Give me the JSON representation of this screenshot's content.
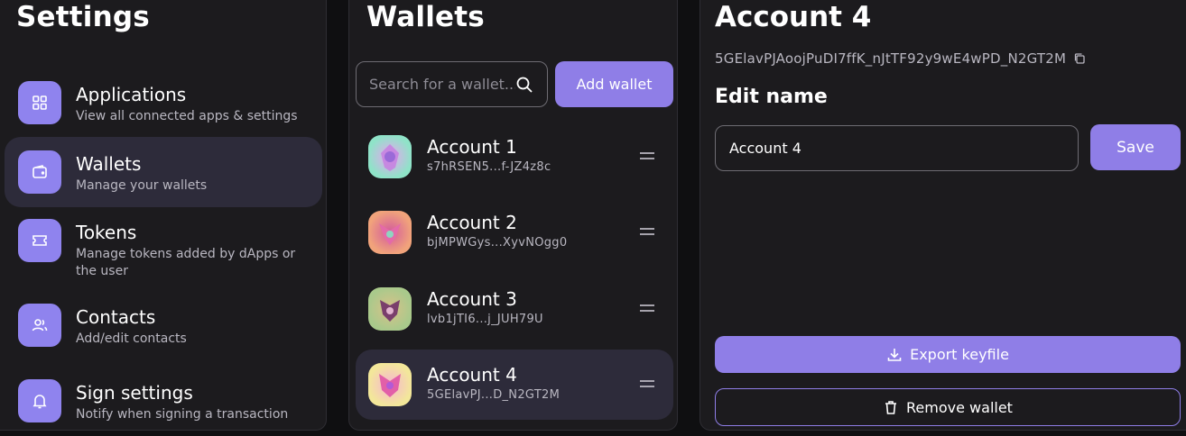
{
  "settings": {
    "title": "Settings",
    "items": [
      {
        "icon": "grid-icon",
        "label": "Applications",
        "description": "View all connected apps & settings"
      },
      {
        "icon": "wallet-icon",
        "label": "Wallets",
        "description": "Manage your wallets"
      },
      {
        "icon": "ticket-icon",
        "label": "Tokens",
        "description": "Manage tokens added by dApps or the user"
      },
      {
        "icon": "users-icon",
        "label": "Contacts",
        "description": "Add/edit contacts"
      },
      {
        "icon": "bell-icon",
        "label": "Sign settings",
        "description": "Notify when signing a transaction"
      }
    ],
    "active_index": 1
  },
  "wallets": {
    "title": "Wallets",
    "search_placeholder": "Search for a wallet...",
    "add_label": "Add wallet",
    "items": [
      {
        "name": "Account 1",
        "address": "s7hRSEN5...f-JZ4z8c",
        "avatar_colors": [
          "#8fe3c8",
          "#c77fe0"
        ]
      },
      {
        "name": "Account 2",
        "address": "bjMPWGys...XyvNOgg0",
        "avatar_colors": [
          "#f1a37b",
          "#d35a9c"
        ]
      },
      {
        "name": "Account 3",
        "address": "lvb1jTI6...j_JUH79U",
        "avatar_colors": [
          "#a9c98b",
          "#9a5a8c"
        ]
      },
      {
        "name": "Account 4",
        "address": "5GElavPJ...D_N2GT2M",
        "avatar_colors": [
          "#f3e79a",
          "#e25fa8"
        ]
      }
    ],
    "active_index": 3
  },
  "detail": {
    "title": "Account 4",
    "address": "5GElavPJAoojPuDI7ffK_nJtTF92y9wE4wPD_N2GT2M",
    "edit_name_title": "Edit name",
    "name_value": "Account 4",
    "save_label": "Save",
    "export_label": "Export keyfile",
    "remove_label": "Remove wallet"
  },
  "colors": {
    "accent": "#8f7ee7",
    "panel_bg": "#1c1b1e",
    "active_bg": "#2d2b3a"
  }
}
